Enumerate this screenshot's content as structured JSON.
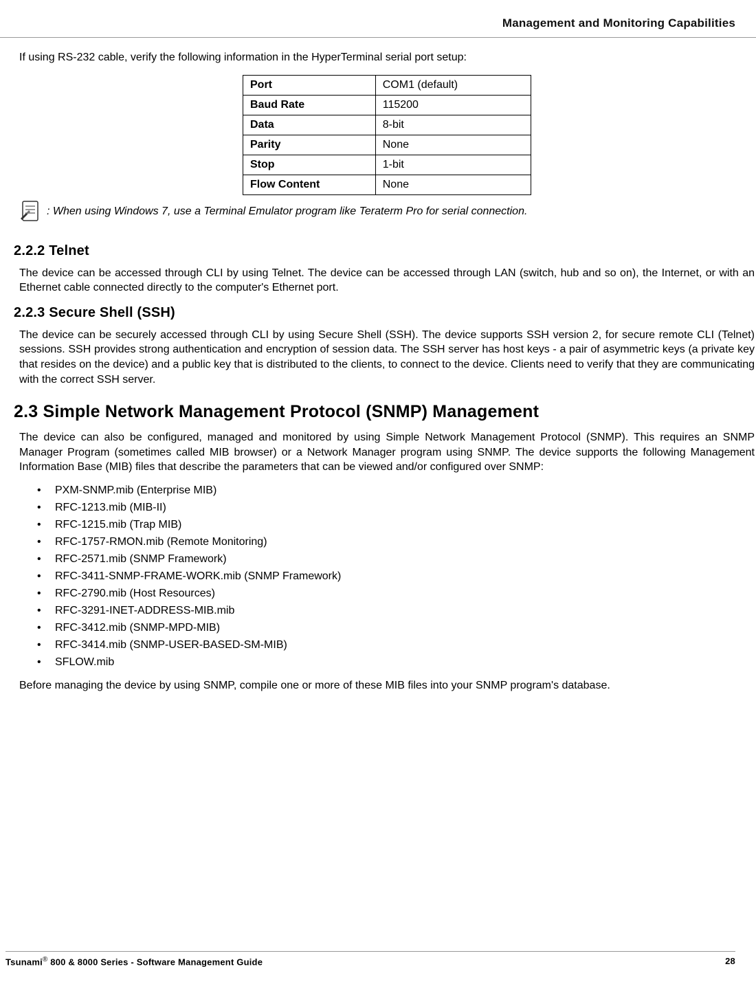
{
  "header": {
    "running_title": "Management and Monitoring Capabilities"
  },
  "intro_paragraph": "If using RS-232 cable, verify the following information in the HyperTerminal serial port setup:",
  "serial_table": [
    {
      "label": "Port",
      "value": "COM1 (default)"
    },
    {
      "label": "Baud Rate",
      "value": "115200"
    },
    {
      "label": "Data",
      "value": "8-bit"
    },
    {
      "label": "Parity",
      "value": "None"
    },
    {
      "label": "Stop",
      "value": "1-bit"
    },
    {
      "label": "Flow Content",
      "value": "None"
    }
  ],
  "note_text": ": When using Windows 7, use a Terminal Emulator program like Teraterm Pro for serial connection.",
  "sections": {
    "telnet": {
      "heading": "2.2.2 Telnet",
      "body": "The device can be accessed through CLI by using Telnet. The device can be accessed through LAN (switch, hub and so on), the Internet, or with an Ethernet cable connected directly to the computer's Ethernet port."
    },
    "ssh": {
      "heading": "2.2.3 Secure Shell (SSH)",
      "body": "The device can be securely accessed through CLI by using Secure Shell (SSH). The device supports SSH version 2, for secure remote CLI (Telnet) sessions. SSH provides strong authentication and encryption of session data. The SSH server has host keys - a pair of asymmetric keys (a private key that resides on the device) and a public key that is distributed to the clients, to connect to the device. Clients need to verify that they are communicating with the correct SSH server."
    },
    "snmp": {
      "heading": "2.3 Simple Network Management Protocol (SNMP) Management",
      "body": "The device can also be configured, managed and monitored by using Simple Network Management Protocol (SNMP). This requires an SNMP Manager Program (sometimes called MIB browser) or a Network Manager program using SNMP. The device supports the following Management Information Base (MIB) files that describe the parameters that can be viewed and/or configured over SNMP:",
      "mibs": [
        "PXM-SNMP.mib (Enterprise MIB)",
        "RFC-1213.mib (MIB-II)",
        "RFC-1215.mib (Trap MIB)",
        "RFC-1757-RMON.mib (Remote Monitoring)",
        "RFC-2571.mib (SNMP Framework)",
        "RFC-3411-SNMP-FRAME-WORK.mib (SNMP Framework)",
        "RFC-2790.mib (Host Resources)",
        "RFC-3291-INET-ADDRESS-MIB.mib",
        "RFC-3412.mib (SNMP-MPD-MIB)",
        "RFC-3414.mib (SNMP-USER-BASED-SM-MIB)",
        "SFLOW.mib"
      ],
      "closing": "Before managing the device by using SNMP, compile one or more of these MIB files into your SNMP program's database."
    }
  },
  "footer": {
    "left_prefix": "Tsunami",
    "left_suffix": " 800 & 8000 Series - Software Management Guide",
    "page_number": "28"
  }
}
